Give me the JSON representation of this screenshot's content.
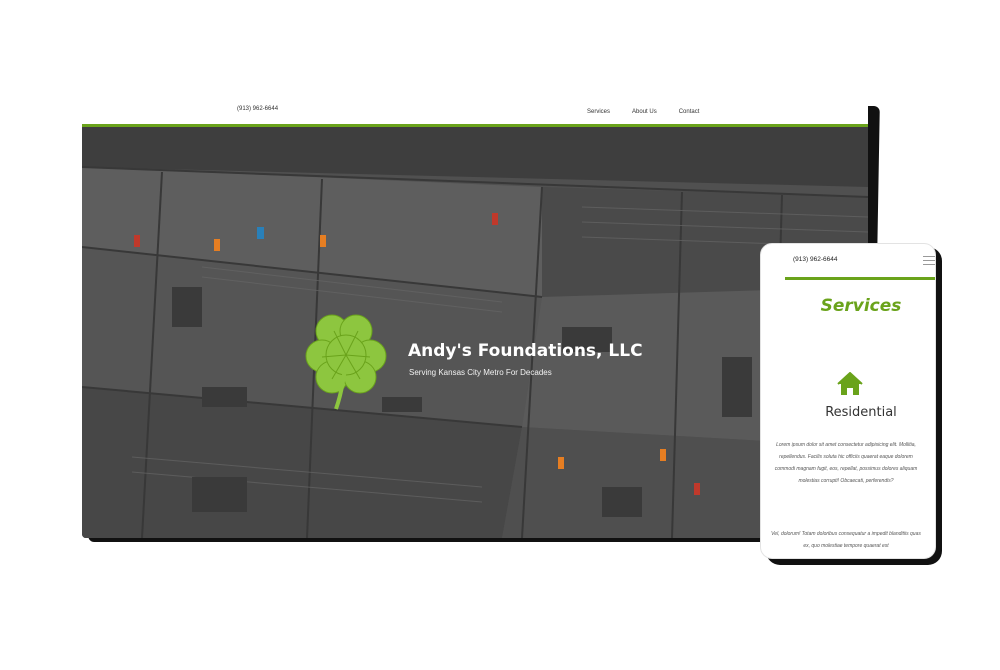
{
  "desktop": {
    "phone": "(913) 962-6644",
    "nav": [
      "Services",
      "About Us",
      "Contact"
    ],
    "hero": {
      "title": "Andy's Foundations, LLC",
      "subtitle": "Serving Kansas City Metro For Decades"
    }
  },
  "mobile": {
    "phone": "(913) 962-6644",
    "section_title": "Services",
    "card_icon": "house-icon",
    "card_title": "Residential",
    "paragraph_1": "Lorem ipsum dolor sit amet consectetur adipisicing elit. Mollitia, repellendus. Facilis soluta hic officiis quaerat eaque dolorem commodi magnam fugit, eos, repellat, possimus dolores aliquam molestias corrupti! Obcaecati, perferendis?",
    "paragraph_2": "Vel, dolorum! Totam doloribus consequatur a impedit blanditiis quas ex, quo molestiae tempore quaerat est"
  },
  "colors": {
    "accent": "#6aa31b",
    "hero_overlay": "#4d4d4d",
    "clover": "#8dc63f"
  }
}
